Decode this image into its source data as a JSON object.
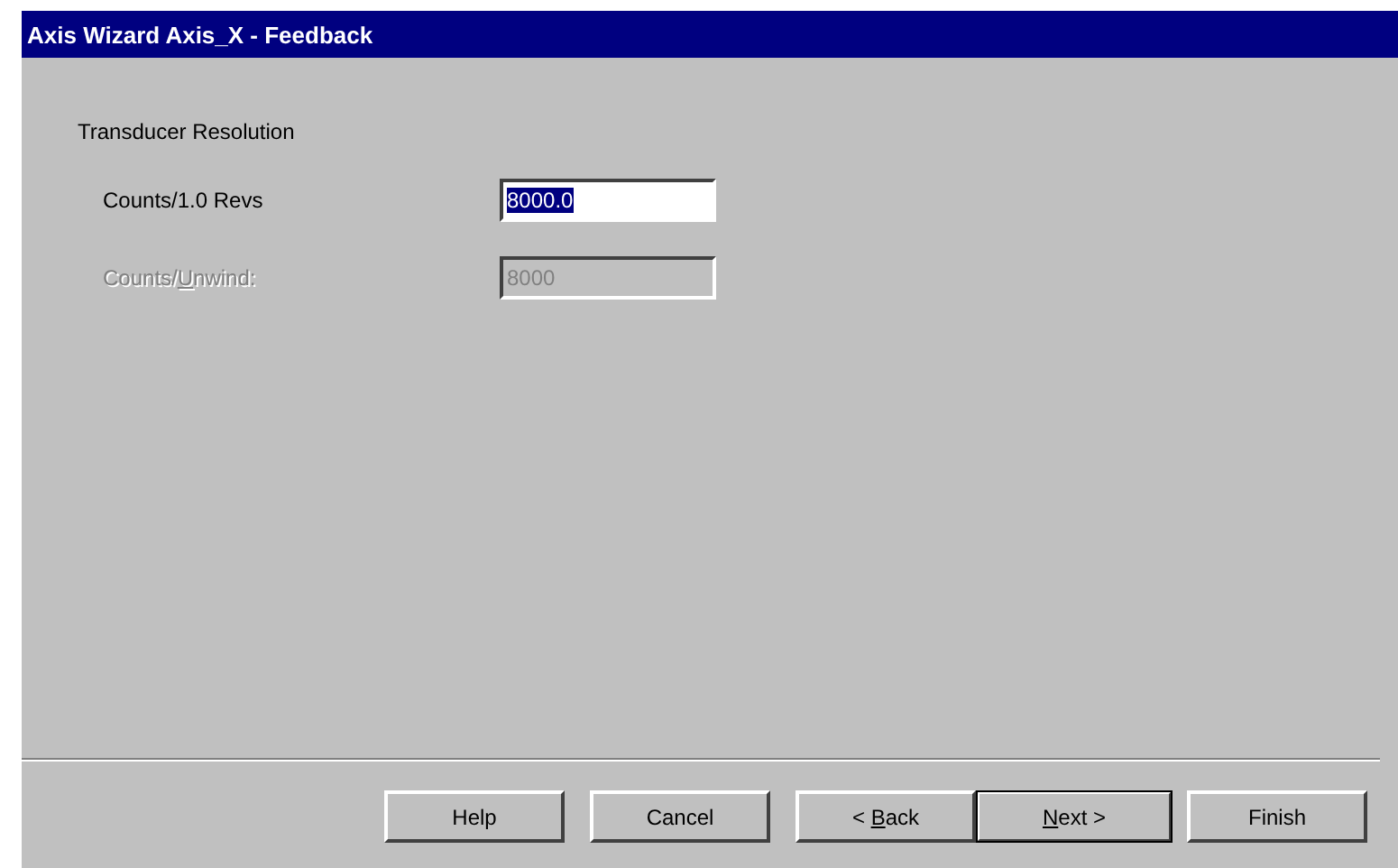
{
  "window": {
    "title": "Axis Wizard Axis_X - Feedback"
  },
  "group_label": "Transducer Resolution",
  "fields": [
    {
      "label": "Counts/1.0 Revs",
      "value": "8000.0",
      "disabled": false,
      "text_selected": true
    },
    {
      "label_before": "Counts/",
      "access_key": "U",
      "label_after": "nwind:",
      "value": "8000",
      "disabled": true,
      "text_selected": false
    }
  ],
  "buttons": [
    {
      "label": "Help",
      "default": false
    },
    {
      "label": "Cancel",
      "default": false
    },
    {
      "label_before": "< ",
      "access_key": "B",
      "label_after": "ack",
      "default": false
    },
    {
      "access_key": "N",
      "label_after": "ext >",
      "default": true
    },
    {
      "label": "Finish",
      "default": false
    }
  ]
}
